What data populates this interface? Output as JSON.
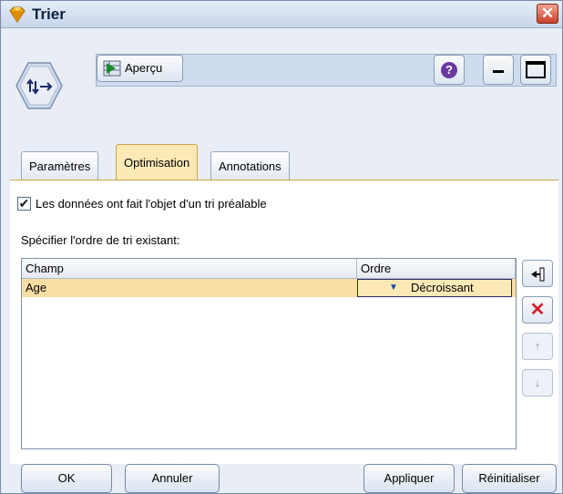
{
  "window": {
    "title": "Trier",
    "close_icon": "close-icon"
  },
  "toolbar": {
    "preview_label": "Aperçu",
    "help_icon": "help-icon",
    "help_glyph": "?",
    "minimize_icon": "minimize-icon",
    "maximize_icon": "maximize-icon"
  },
  "tabs": [
    {
      "label": "Paramètres",
      "active": false
    },
    {
      "label": "Optimisation",
      "active": true
    },
    {
      "label": "Annotations",
      "active": false
    }
  ],
  "optimisation": {
    "presorted_checked": true,
    "presorted_label": "Les données ont fait l'objet d'un tri préalable",
    "order_label": "Spécifier l'ordre de tri existant:"
  },
  "sort_table": {
    "columns": [
      "Champ",
      "Ordre"
    ],
    "rows": [
      {
        "field": "Age",
        "order": "Décroissant",
        "selected": true
      }
    ]
  },
  "side_buttons": {
    "add_icon": "add-field-icon",
    "delete_icon": "delete-icon",
    "up_icon": "move-up-icon",
    "down_icon": "move-down-icon",
    "delete_glyph": "✕",
    "up_glyph": "↑",
    "down_glyph": "↓"
  },
  "buttons": {
    "ok": "OK",
    "cancel": "Annuler",
    "apply": "Appliquer",
    "reset": "Réinitialiser"
  },
  "colors": {
    "active_tab": "#fde9b6",
    "selected_row": "#f9dea3",
    "delete_red": "#d8202a",
    "help_purple": "#6a3aa0"
  }
}
